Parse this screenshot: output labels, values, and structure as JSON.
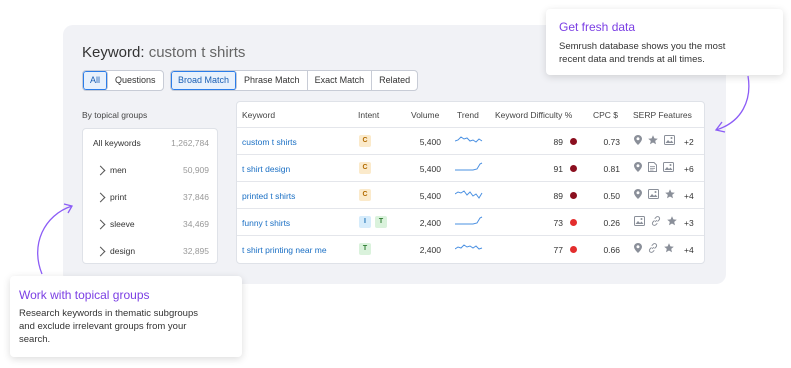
{
  "header": {
    "keyword_label": "Keyword:",
    "keyword_value": "custom t shirts"
  },
  "filters": {
    "scope": [
      {
        "label": "All",
        "active": true
      },
      {
        "label": "Questions",
        "active": false
      }
    ],
    "match": [
      {
        "label": "Broad Match",
        "active": true
      },
      {
        "label": "Phrase Match",
        "active": false
      },
      {
        "label": "Exact Match",
        "active": false
      },
      {
        "label": "Related",
        "active": false
      }
    ]
  },
  "groups": {
    "title": "By topical groups",
    "all": {
      "label": "All keywords",
      "count": "1,262,784"
    },
    "items": [
      {
        "label": "men",
        "count": "50,909"
      },
      {
        "label": "print",
        "count": "37,846"
      },
      {
        "label": "sleeve",
        "count": "34,469"
      },
      {
        "label": "design",
        "count": "32,895"
      }
    ]
  },
  "table": {
    "headers": {
      "keyword": "Keyword",
      "intent": "Intent",
      "volume": "Volume",
      "trend": "Trend",
      "kd": "Keyword Difficulty %",
      "cpc": "CPC $",
      "serp": "SERP Features"
    },
    "rows": [
      {
        "keyword": "custom t shirts",
        "intent": [
          "C"
        ],
        "volume": "5,400",
        "kd": "89",
        "kd_color": "#8b0f1f",
        "cpc": "0.73",
        "serp_icons": [
          "pin-icon",
          "star-icon",
          "image-icon"
        ],
        "serp_more": "+2"
      },
      {
        "keyword": "t shirt design",
        "intent": [
          "C"
        ],
        "volume": "5,400",
        "kd": "91",
        "kd_color": "#8b0f1f",
        "cpc": "0.81",
        "serp_icons": [
          "pin-icon",
          "document-icon",
          "image-icon"
        ],
        "serp_more": "+6"
      },
      {
        "keyword": "printed t shirts",
        "intent": [
          "C"
        ],
        "volume": "5,400",
        "kd": "89",
        "kd_color": "#8b0f1f",
        "cpc": "0.50",
        "serp_icons": [
          "pin-icon",
          "image-icon",
          "star-icon"
        ],
        "serp_more": "+4"
      },
      {
        "keyword": "funny t shirts",
        "intent": [
          "I",
          "T"
        ],
        "volume": "2,400",
        "kd": "73",
        "kd_color": "#e32d2d",
        "cpc": "0.26",
        "serp_icons": [
          "image-icon",
          "link-icon",
          "star-icon"
        ],
        "serp_more": "+3"
      },
      {
        "keyword": "t shirt printing near me",
        "intent": [
          "T"
        ],
        "volume": "2,400",
        "kd": "77",
        "kd_color": "#e32d2d",
        "cpc": "0.66",
        "serp_icons": [
          "pin-icon",
          "link-icon",
          "star-icon"
        ],
        "serp_more": "+4"
      }
    ]
  },
  "callouts": {
    "fresh": {
      "title": "Get fresh data",
      "desc_1": "Semrush database shows you the most",
      "desc_2": "recent data and trends at all times."
    },
    "groups": {
      "title": "Work with topical groups",
      "desc_1": "Research keywords in thematic subgroups",
      "desc_2": "and exclude irrelevant groups from your",
      "desc_3": "search."
    }
  },
  "colors": {
    "accent": "#7b3fe4",
    "link": "#1a6fc4",
    "trend": "#4a90e2",
    "panel": "#f1f2f6"
  }
}
